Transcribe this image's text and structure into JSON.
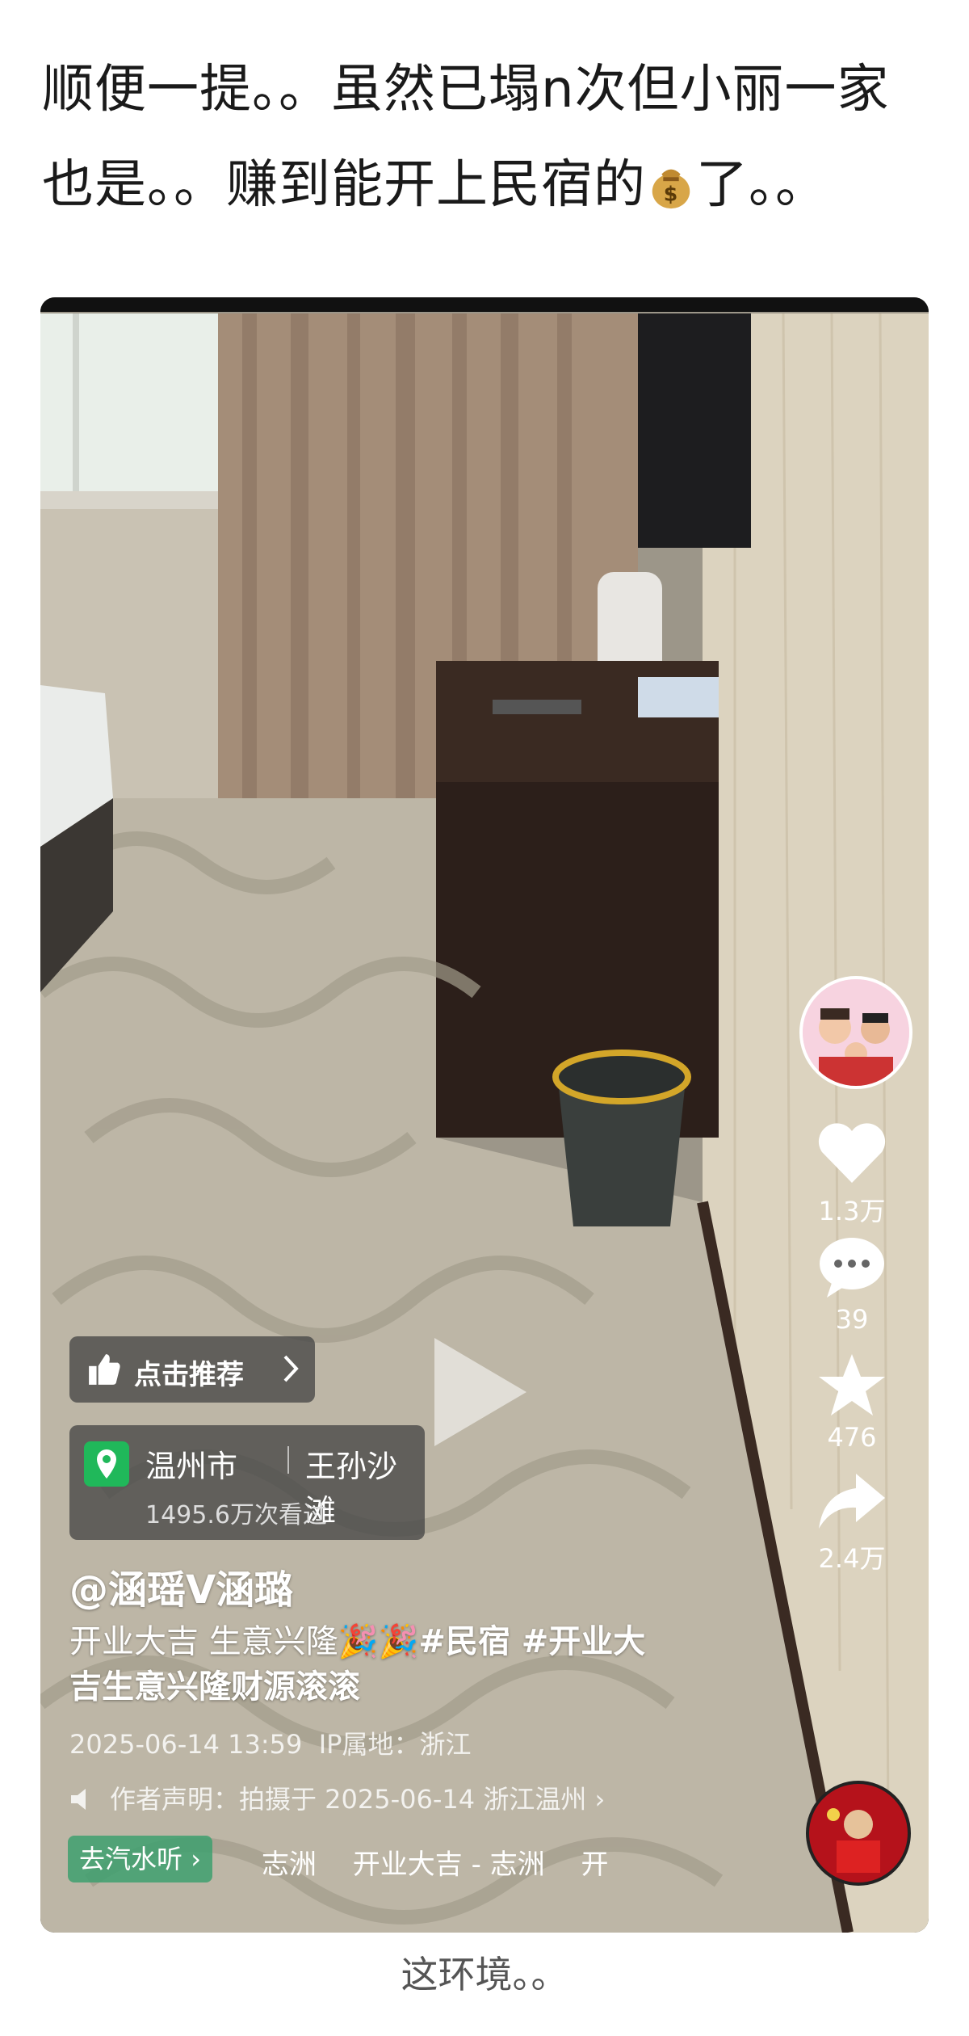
{
  "post": {
    "line1": "顺便一提。。虽然已塌n次但小丽一家",
    "line2_before": "也是。。赚到能开上民宿的",
    "money_emoji": "money-bag",
    "line2_after": "了。。"
  },
  "video": {
    "recommend_label": "点击推荐",
    "location": {
      "city": "温州市",
      "spot": "王孙沙滩",
      "views": "1495.6万次看过"
    },
    "author": "@涵瑶V涵璐",
    "caption_text": "开业大吉 生意兴隆",
    "caption_tags_line1": "#民宿 #开业大",
    "caption_tags_line2": "吉生意兴隆财源滚滚",
    "timestamp": "2025-06-14 13:59",
    "ip_location": "IP属地：浙江",
    "disclaimer": "作者声明：拍摄于 2025-06-14 浙江温州",
    "music_button": "去汽水听",
    "music_track": "志洲　 开业大吉 - 志洲　 开",
    "actions": {
      "likes": "1.3万",
      "comments": "39",
      "favorites": "476",
      "shares": "2.4万"
    }
  },
  "bottom_caption": "这环境。。",
  "colors": {
    "location_pin": "#20b85a",
    "music_pill": "#3ea06e",
    "disc": "#b5121b"
  }
}
